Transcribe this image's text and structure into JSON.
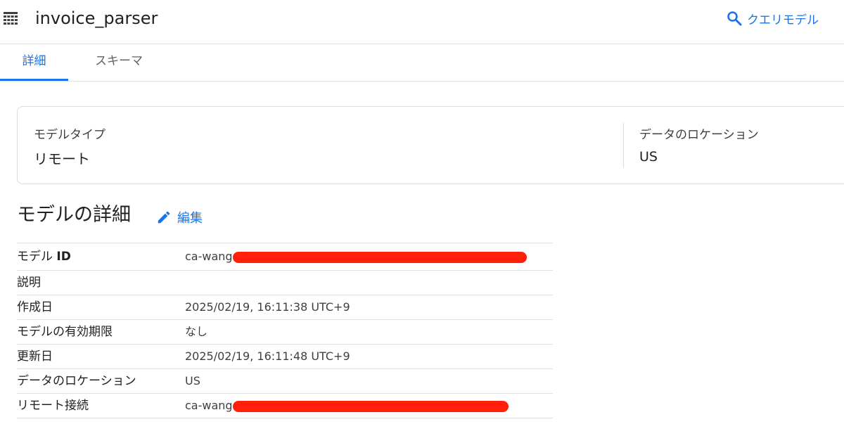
{
  "header": {
    "title": "invoice_parser",
    "query_button_label": "クエリモデル",
    "model_icon": "table-grid-icon",
    "query_icon": "search-icon"
  },
  "tabs": [
    {
      "label": "詳細",
      "active": true
    },
    {
      "label": "スキーマ",
      "active": false
    }
  ],
  "summary": {
    "model_type_label": "モデルタイプ",
    "model_type_value": "リモート",
    "location_label": "データのロケーション",
    "location_value": "US"
  },
  "details": {
    "title": "モデルの詳細",
    "edit_label": "編集",
    "edit_icon": "pencil-icon",
    "rows": [
      {
        "label_prefix": "モデル ",
        "label_bold": "ID",
        "value": "ca-wang",
        "redacted": true
      },
      {
        "label": "説明",
        "value": ""
      },
      {
        "label": "作成日",
        "value": "2025/02/19, 16:11:38 UTC+9"
      },
      {
        "label": "モデルの有効期限",
        "value": "なし"
      },
      {
        "label": "更新日",
        "value": "2025/02/19, 16:11:48 UTC+9"
      },
      {
        "label": "データのロケーション",
        "value": "US"
      },
      {
        "label": "リモート接続",
        "value": "ca-wang",
        "redacted": true
      }
    ]
  },
  "colors": {
    "accent": "#1a73e8",
    "redaction": "#ff1f0a"
  }
}
